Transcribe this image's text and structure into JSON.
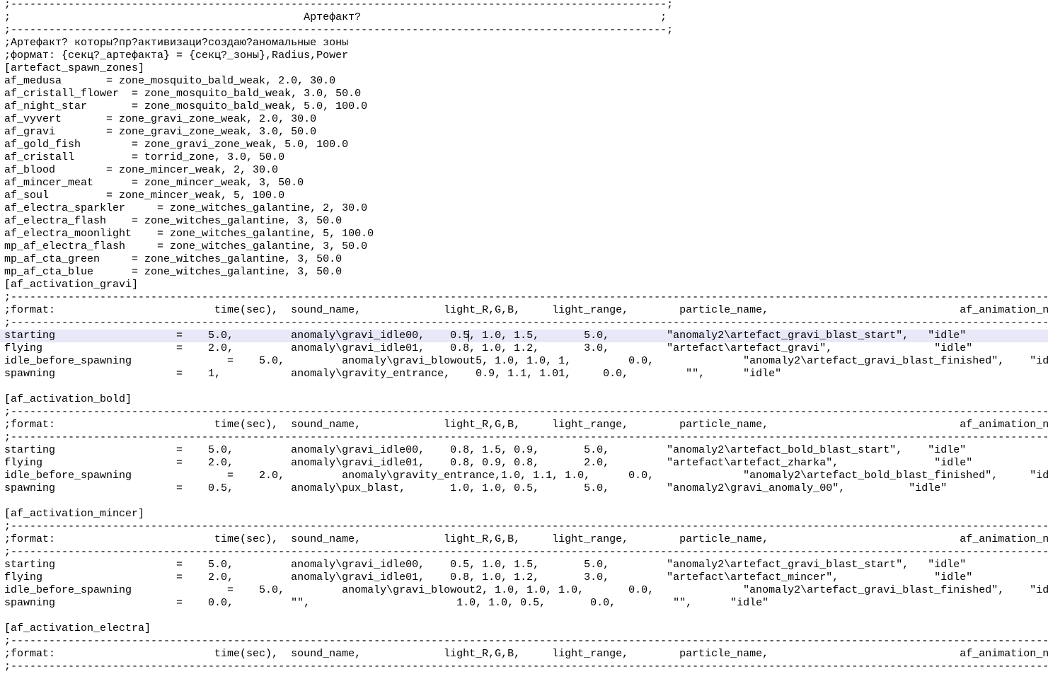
{
  "editor": {
    "current_line_index": 26,
    "lines": [
      ";-------------------------------------------------------------------------------------------------------;",
      ";                                              Артефакт?                                               ;",
      ";-------------------------------------------------------------------------------------------------------;",
      ";Артефакт? которы?пр?активизаци?создаю?аномальные зоны",
      ";формат: {секц?_артефакта} = {секц?_зоны},Radius,Power",
      "[artefact_spawn_zones]",
      "af_medusa       = zone_mosquito_bald_weak, 2.0, 30.0",
      "af_cristall_flower  = zone_mosquito_bald_weak, 3.0, 50.0",
      "af_night_star       = zone_mosquito_bald_weak, 5.0, 100.0",
      "af_vyvert       = zone_gravi_zone_weak, 2.0, 30.0",
      "af_gravi        = zone_gravi_zone_weak, 3.0, 50.0",
      "af_gold_fish        = zone_gravi_zone_weak, 5.0, 100.0",
      "af_cristall         = torrid_zone, 3.0, 50.0",
      "af_blood        = zone_mincer_weak, 2, 30.0",
      "af_mincer_meat      = zone_mincer_weak, 3, 50.0",
      "af_soul         = zone_mincer_weak, 5, 100.0",
      "af_electra_sparkler     = zone_witches_galantine, 2, 30.0",
      "af_electra_flash    = zone_witches_galantine, 3, 50.0",
      "af_electra_moonlight    = zone_witches_galantine, 5, 100.0",
      "mp_af_electra_flash     = zone_witches_galantine, 3, 50.0",
      "mp_af_cta_green     = zone_witches_galantine, 3, 50.0",
      "mp_af_cta_blue      = zone_witches_galantine, 3, 50.0",
      "[af_activation_gravi]",
      ";-------------------------------------------------------------------------------------------------------------------------------------------------------------------------",
      ";format:                         time(sec),  sound_name,             light_R,G,B,     light_range,        particle_name,                              af_animation_name",
      ";-------------------------------------------------------------------------------------------------------------------------------------------------------------------------",
      "starting                   =    5.0,         anomaly\\gravi_idle00,    0.5, 1.0, 1.5,       5.0,         \"anomaly2\\artefact_gravi_blast_start\",   \"idle\"",
      "flying                     =    2.0,         anomaly\\gravi_idle01,    0.8, 1.0, 1.2,       3.0,         \"artefact\\artefact_gravi\",                \"idle\"",
      "idle_before_spawning               =    5.0,         anomaly\\gravi_blowout5, 1.0, 1.0, 1,         0.0,              \"anomaly2\\artefact_gravi_blast_finished\",    \"idle\"",
      "spawning                   =    1,           anomaly\\gravity_entrance,    0.9, 1.1, 1.01,     0.0,         \"\",      \"idle\"",
      "",
      "[af_activation_bold]",
      ";-------------------------------------------------------------------------------------------------------------------------------------------------------------------------",
      ";format:                         time(sec),  sound_name,             light_R,G,B,     light_range,        particle_name,                              af_animation_name",
      ";-------------------------------------------------------------------------------------------------------------------------------------------------------------------------",
      "starting                   =    5.0,         anomaly\\gravi_idle00,    0.8, 1.5, 0.9,       5.0,         \"anomaly2\\artefact_bold_blast_start\",    \"idle\"",
      "flying                     =    2.0,         anomaly\\gravi_idle01,    0.8, 0.9, 0.8,       2.0,         \"artefact\\artefact_zharka\",               \"idle\"",
      "idle_before_spawning               =    2.0,         anomaly\\gravity_entrance,1.0, 1.1, 1.0,      0.0,              \"anomaly2\\artefact_bold_blast_finished\",     \"idle\"",
      "spawning                   =    0.5,         anomaly\\pux_blast,       1.0, 1.0, 0.5,       5.0,         \"anomaly2\\gravi_anomaly_00\",          \"idle\"",
      "",
      "[af_activation_mincer]",
      ";-------------------------------------------------------------------------------------------------------------------------------------------------------------------------",
      ";format:                         time(sec),  sound_name,             light_R,G,B,     light_range,        particle_name,                              af_animation_name",
      ";-------------------------------------------------------------------------------------------------------------------------------------------------------------------------",
      "starting                   =    5.0,         anomaly\\gravi_idle00,    0.5, 1.0, 1.5,       5.0,         \"anomaly2\\artefact_gravi_blast_start\",   \"idle\"",
      "flying                     =    2.0,         anomaly\\gravi_idle01,    0.8, 1.0, 1.2,       3.0,         \"artefact\\artefact_mincer\",               \"idle\"",
      "idle_before_spawning               =    5.0,         anomaly\\gravi_blowout2, 1.0, 1.0, 1.0,       0.0,              \"anomaly2\\artefact_gravi_blast_finished\",    \"idle\"",
      "spawning                   =    0.0,         \"\",                       1.0, 1.0, 0.5,       0.0,         \"\",      \"idle\"",
      "",
      "[af_activation_electra]",
      ";-------------------------------------------------------------------------------------------------------------------------------------------------------------------------",
      ";format:                         time(sec),  sound_name,             light_R,G,B,     light_range,        particle_name,                              af_animation_name",
      ";-------------------------------------------------------------------------------------------------------------------------------------------------------------------------"
    ]
  }
}
